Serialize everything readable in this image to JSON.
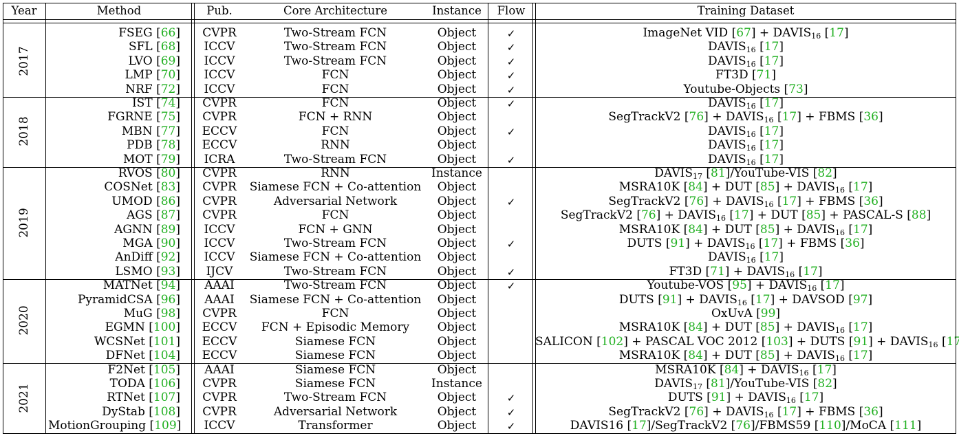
{
  "headers": {
    "year": "Year",
    "method": "Method",
    "pub": "Pub.",
    "arch": "Core Architecture",
    "instance": "Instance",
    "flow": "Flow",
    "dataset": "Training Dataset"
  },
  "check": "✓",
  "groups": [
    {
      "year": "2017",
      "rows": [
        {
          "method": "FSEG",
          "ref": "66",
          "pub": "CVPR",
          "arch": "Two-Stream FCN",
          "instance": "Object",
          "flow": true,
          "dataset": [
            {
              "t": "ImageNet VID "
            },
            {
              "r": "67"
            },
            {
              "t": " + DAVIS"
            },
            {
              "s": "16"
            },
            {
              "t": " "
            },
            {
              "r": "17"
            }
          ]
        },
        {
          "method": "SFL",
          "ref": "68",
          "pub": "ICCV",
          "arch": "Two-Stream FCN",
          "instance": "Object",
          "flow": true,
          "dataset": [
            {
              "t": "DAVIS"
            },
            {
              "s": "16"
            },
            {
              "t": " "
            },
            {
              "r": "17"
            }
          ]
        },
        {
          "method": "LVO",
          "ref": "69",
          "pub": "ICCV",
          "arch": "Two-Stream FCN",
          "instance": "Object",
          "flow": true,
          "dataset": [
            {
              "t": "DAVIS"
            },
            {
              "s": "16"
            },
            {
              "t": " "
            },
            {
              "r": "17"
            }
          ]
        },
        {
          "method": "LMP",
          "ref": "70",
          "pub": "ICCV",
          "arch": "FCN",
          "instance": "Object",
          "flow": true,
          "dataset": [
            {
              "t": "FT3D "
            },
            {
              "r": "71"
            }
          ]
        },
        {
          "method": "NRF",
          "ref": "72",
          "pub": "ICCV",
          "arch": "FCN",
          "instance": "Object",
          "flow": true,
          "dataset": [
            {
              "t": "Youtube-Objects "
            },
            {
              "r": "73"
            }
          ]
        }
      ]
    },
    {
      "year": "2018",
      "rows": [
        {
          "method": "IST",
          "ref": "74",
          "pub": "CVPR",
          "arch": "FCN",
          "instance": "Object",
          "flow": true,
          "dataset": [
            {
              "t": "DAVIS"
            },
            {
              "s": "16"
            },
            {
              "t": " "
            },
            {
              "r": "17"
            }
          ]
        },
        {
          "method": "FGRNE",
          "ref": "75",
          "pub": "CVPR",
          "arch": "FCN + RNN",
          "instance": "Object",
          "flow": false,
          "dataset": [
            {
              "t": "SegTrackV2 "
            },
            {
              "r": "76"
            },
            {
              "t": " + DAVIS"
            },
            {
              "s": "16"
            },
            {
              "t": " "
            },
            {
              "r": "17"
            },
            {
              "t": " + FBMS "
            },
            {
              "r": "36"
            }
          ]
        },
        {
          "method": "MBN",
          "ref": "77",
          "pub": "ECCV",
          "arch": "FCN",
          "instance": "Object",
          "flow": true,
          "dataset": [
            {
              "t": "DAVIS"
            },
            {
              "s": "16"
            },
            {
              "t": " "
            },
            {
              "r": "17"
            }
          ]
        },
        {
          "method": "PDB",
          "ref": "78",
          "pub": "ECCV",
          "arch": "RNN",
          "instance": "Object",
          "flow": false,
          "dataset": [
            {
              "t": "DAVIS"
            },
            {
              "s": "16"
            },
            {
              "t": " "
            },
            {
              "r": "17"
            }
          ]
        },
        {
          "method": "MOT",
          "ref": "79",
          "pub": "ICRA",
          "arch": "Two-Stream FCN",
          "instance": "Object",
          "flow": true,
          "dataset": [
            {
              "t": "DAVIS"
            },
            {
              "s": "16"
            },
            {
              "t": " "
            },
            {
              "r": "17"
            }
          ]
        }
      ]
    },
    {
      "year": "2019",
      "rows": [
        {
          "method": "RVOS",
          "ref": "80",
          "pub": "CVPR",
          "arch": "RNN",
          "instance": "Instance",
          "flow": false,
          "dataset": [
            {
              "t": "DAVIS"
            },
            {
              "s": "17"
            },
            {
              "t": " "
            },
            {
              "r": "81"
            },
            {
              "t": "/YouTube-VIS "
            },
            {
              "r": "82"
            }
          ]
        },
        {
          "method": "COSNet",
          "ref": "83",
          "pub": "CVPR",
          "arch": "Siamese FCN + Co-attention",
          "instance": "Object",
          "flow": false,
          "dataset": [
            {
              "t": "MSRA10K "
            },
            {
              "r": "84"
            },
            {
              "t": " + DUT "
            },
            {
              "r": "85"
            },
            {
              "t": " + DAVIS"
            },
            {
              "s": "16"
            },
            {
              "t": " "
            },
            {
              "r": "17"
            }
          ]
        },
        {
          "method": "UMOD",
          "ref": "86",
          "pub": "CVPR",
          "arch": "Adversarial Network",
          "instance": "Object",
          "flow": true,
          "dataset": [
            {
              "t": "SegTrackV2 "
            },
            {
              "r": "76"
            },
            {
              "t": " + DAVIS"
            },
            {
              "s": "16"
            },
            {
              "t": " "
            },
            {
              "r": "17"
            },
            {
              "t": " + FBMS "
            },
            {
              "r": "36"
            }
          ]
        },
        {
          "method": "AGS",
          "ref": "87",
          "pub": "CVPR",
          "arch": "FCN",
          "instance": "Object",
          "flow": false,
          "dataset": [
            {
              "t": "SegTrackV2 "
            },
            {
              "r": "76"
            },
            {
              "t": " + DAVIS"
            },
            {
              "s": "16"
            },
            {
              "t": " "
            },
            {
              "r": "17"
            },
            {
              "t": " + DUT "
            },
            {
              "r": "85"
            },
            {
              "t": " + PASCAL-S "
            },
            {
              "r": "88"
            }
          ]
        },
        {
          "method": "AGNN",
          "ref": "89",
          "pub": "ICCV",
          "arch": "FCN + GNN",
          "instance": "Object",
          "flow": false,
          "dataset": [
            {
              "t": "MSRA10K "
            },
            {
              "r": "84"
            },
            {
              "t": " + DUT "
            },
            {
              "r": "85"
            },
            {
              "t": " + DAVIS"
            },
            {
              "s": "16"
            },
            {
              "t": " "
            },
            {
              "r": "17"
            }
          ]
        },
        {
          "method": "MGA",
          "ref": "90",
          "pub": "ICCV",
          "arch": "Two-Stream FCN",
          "instance": "Object",
          "flow": true,
          "dataset": [
            {
              "t": "DUTS "
            },
            {
              "r": "91"
            },
            {
              "t": " + DAVIS"
            },
            {
              "s": "16"
            },
            {
              "t": " "
            },
            {
              "r": "17"
            },
            {
              "t": " + FBMS "
            },
            {
              "r": "36"
            }
          ]
        },
        {
          "method": "AnDiff",
          "ref": "92",
          "pub": "ICCV",
          "arch": "Siamese FCN + Co-attention",
          "instance": "Object",
          "flow": false,
          "dataset": [
            {
              "t": "DAVIS"
            },
            {
              "s": "16"
            },
            {
              "t": " "
            },
            {
              "r": "17"
            }
          ]
        },
        {
          "method": "LSMO",
          "ref": "93",
          "pub": "IJCV",
          "arch": "Two-Stream FCN",
          "instance": "Object",
          "flow": true,
          "dataset": [
            {
              "t": "FT3D "
            },
            {
              "r": "71"
            },
            {
              "t": " + DAVIS"
            },
            {
              "s": "16"
            },
            {
              "t": " "
            },
            {
              "r": "17"
            }
          ]
        }
      ]
    },
    {
      "year": "2020",
      "rows": [
        {
          "method": "MATNet",
          "ref": "94",
          "pub": "AAAI",
          "arch": "Two-Stream FCN",
          "instance": "Object",
          "flow": true,
          "dataset": [
            {
              "t": "Youtube-VOS "
            },
            {
              "r": "95"
            },
            {
              "t": " + DAVIS"
            },
            {
              "s": "16"
            },
            {
              "t": " "
            },
            {
              "r": "17"
            }
          ]
        },
        {
          "method": "PyramidCSA",
          "ref": "96",
          "pub": "AAAI",
          "arch": "Siamese FCN + Co-attention",
          "instance": "Object",
          "flow": false,
          "dataset": [
            {
              "t": "DUTS "
            },
            {
              "r": "91"
            },
            {
              "t": " + DAVIS"
            },
            {
              "s": "16"
            },
            {
              "t": " "
            },
            {
              "r": "17"
            },
            {
              "t": " + DAVSOD "
            },
            {
              "r": "97"
            }
          ]
        },
        {
          "method": "MuG",
          "ref": "98",
          "pub": "CVPR",
          "arch": "FCN",
          "instance": "Object",
          "flow": false,
          "dataset": [
            {
              "t": "OxUvA "
            },
            {
              "r": "99"
            }
          ]
        },
        {
          "method": "EGMN",
          "ref": "100",
          "pub": "ECCV",
          "arch": "FCN + Episodic Memory",
          "instance": "Object",
          "flow": false,
          "dataset": [
            {
              "t": "MSRA10K "
            },
            {
              "r": "84"
            },
            {
              "t": " + DUT "
            },
            {
              "r": "85"
            },
            {
              "t": " + DAVIS"
            },
            {
              "s": "16"
            },
            {
              "t": " "
            },
            {
              "r": "17"
            }
          ]
        },
        {
          "method": "WCSNet",
          "ref": "101",
          "pub": "ECCV",
          "arch": "Siamese FCN",
          "instance": "Object",
          "flow": false,
          "dataset": [
            {
              "t": "SALICON "
            },
            {
              "r": "102"
            },
            {
              "t": " + PASCAL VOC 2012 "
            },
            {
              "r": "103"
            },
            {
              "t": " + DUTS "
            },
            {
              "r": "91"
            },
            {
              "t": " + DAVIS"
            },
            {
              "s": "16"
            },
            {
              "t": " "
            },
            {
              "r": "17"
            }
          ]
        },
        {
          "method": "DFNet",
          "ref": "104",
          "pub": "ECCV",
          "arch": "Siamese FCN",
          "instance": "Object",
          "flow": false,
          "dataset": [
            {
              "t": "MSRA10K "
            },
            {
              "r": "84"
            },
            {
              "t": " + DUT "
            },
            {
              "r": "85"
            },
            {
              "t": " + DAVIS"
            },
            {
              "s": "16"
            },
            {
              "t": " "
            },
            {
              "r": "17"
            }
          ]
        }
      ]
    },
    {
      "year": "2021",
      "rows": [
        {
          "method": "F2Net",
          "ref": "105",
          "pub": "AAAI",
          "arch": "Siamese FCN",
          "instance": "Object",
          "flow": false,
          "dataset": [
            {
              "t": "MSRA10K "
            },
            {
              "r": "84"
            },
            {
              "t": " + DAVIS"
            },
            {
              "s": "16"
            },
            {
              "t": " "
            },
            {
              "r": "17"
            }
          ]
        },
        {
          "method": "TODA",
          "ref": "106",
          "pub": "CVPR",
          "arch": "Siamese FCN",
          "instance": "Instance",
          "flow": false,
          "dataset": [
            {
              "t": "DAVIS"
            },
            {
              "s": "17"
            },
            {
              "t": " "
            },
            {
              "r": "81"
            },
            {
              "t": "/YouTube-VIS "
            },
            {
              "r": "82"
            }
          ]
        },
        {
          "method": "RTNet",
          "ref": "107",
          "pub": "CVPR",
          "arch": "Two-Stream FCN",
          "instance": "Object",
          "flow": true,
          "dataset": [
            {
              "t": "DUTS "
            },
            {
              "r": "91"
            },
            {
              "t": " + DAVIS"
            },
            {
              "s": "16"
            },
            {
              "t": " "
            },
            {
              "r": "17"
            }
          ]
        },
        {
          "method": "DyStab",
          "ref": "108",
          "pub": "CVPR",
          "arch": "Adversarial Network",
          "instance": "Object",
          "flow": true,
          "dataset": [
            {
              "t": "SegTrackV2 "
            },
            {
              "r": "76"
            },
            {
              "t": " + DAVIS"
            },
            {
              "s": "16"
            },
            {
              "t": " "
            },
            {
              "r": "17"
            },
            {
              "t": " + FBMS "
            },
            {
              "r": "36"
            }
          ]
        },
        {
          "method": "MotionGrouping",
          "ref": "109",
          "pub": "ICCV",
          "arch": "Transformer",
          "instance": "Object",
          "flow": true,
          "dataset": [
            {
              "t": "DAVIS16 "
            },
            {
              "r": "17"
            },
            {
              "t": "/SegTrackV2 "
            },
            {
              "r": "76"
            },
            {
              "t": "/FBMS59 "
            },
            {
              "r": "110"
            },
            {
              "t": "/MoCA "
            },
            {
              "r": "111"
            }
          ]
        }
      ]
    }
  ],
  "colors": {
    "ref": "#22b022"
  }
}
